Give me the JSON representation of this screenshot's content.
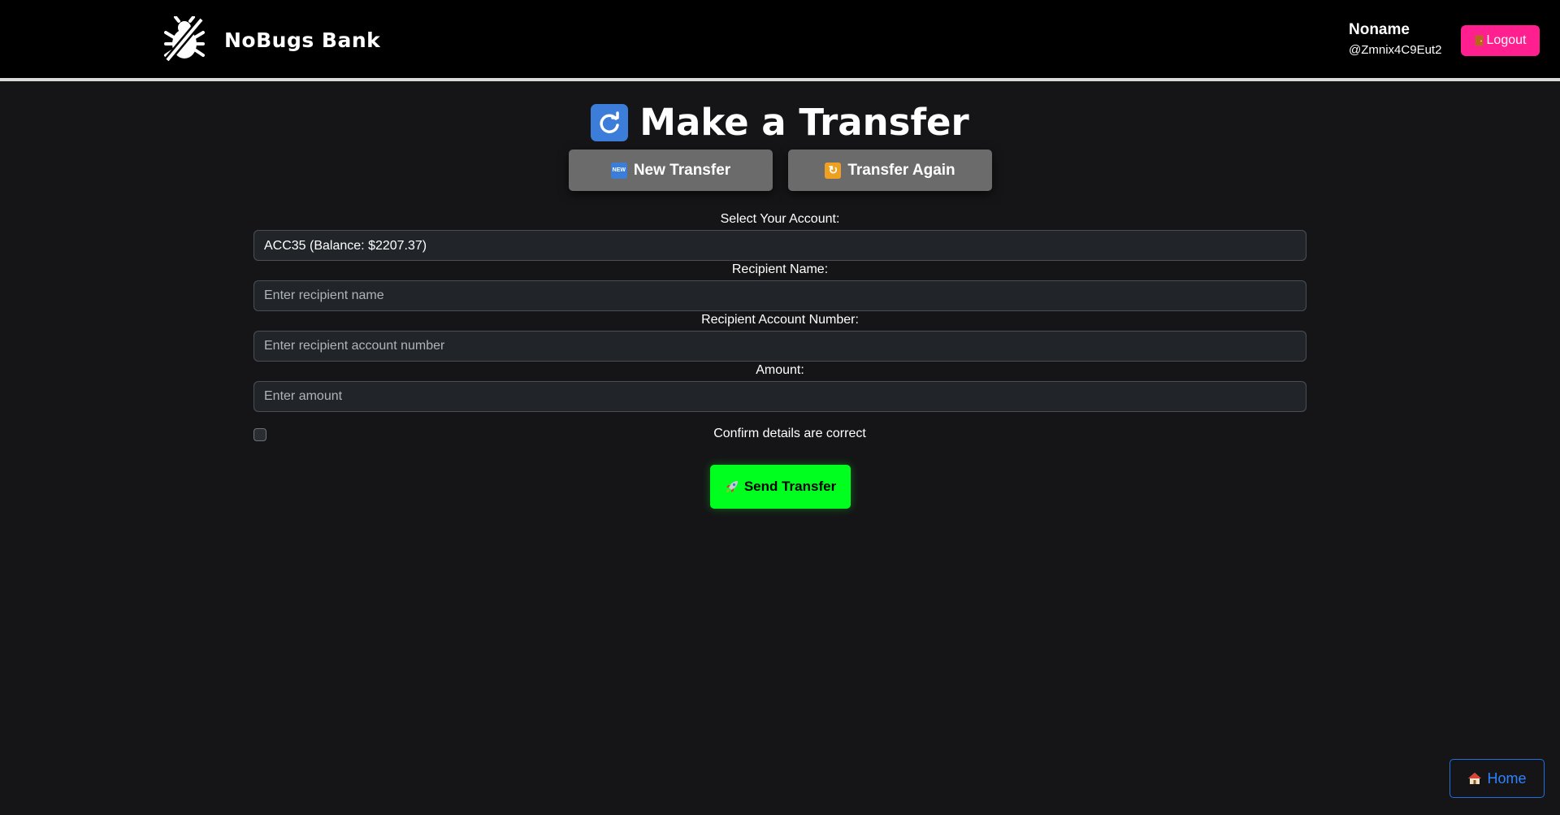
{
  "header": {
    "brand_name": "NoBugs Bank",
    "logo_icon": "bug-slash-icon",
    "user": {
      "name": "Noname",
      "handle": "@Zmnix4C9Eut2"
    },
    "logout_label": "Logout",
    "logout_icon": "door-icon"
  },
  "page": {
    "title": "Make a Transfer",
    "title_icon": "arrows-counterclockwise-icon"
  },
  "mode_buttons": {
    "new_transfer": {
      "label": "New Transfer",
      "icon": "new-badge-icon"
    },
    "transfer_again": {
      "label": "Transfer Again",
      "icon": "repeat-icon"
    }
  },
  "form": {
    "account": {
      "label": "Select Your Account:",
      "selected": "ACC35 (Balance: $2207.37)"
    },
    "recipient_name": {
      "label": "Recipient Name:",
      "placeholder": "Enter recipient name",
      "value": ""
    },
    "recipient_account": {
      "label": "Recipient Account Number:",
      "placeholder": "Enter recipient account number",
      "value": ""
    },
    "amount": {
      "label": "Amount:",
      "placeholder": "Enter amount",
      "value": ""
    },
    "confirm_label": "Confirm details are correct",
    "send_label": "Send Transfer",
    "send_icon": "rocket-icon"
  },
  "footer": {
    "home_label": "Home",
    "home_icon": "house-icon"
  },
  "colors": {
    "background": "#151517",
    "header_bg": "#000000",
    "logout": "#ff1f8f",
    "send": "#00ff1e",
    "mode_button": "#6b6b6b",
    "home_border": "#1f6fe0"
  }
}
